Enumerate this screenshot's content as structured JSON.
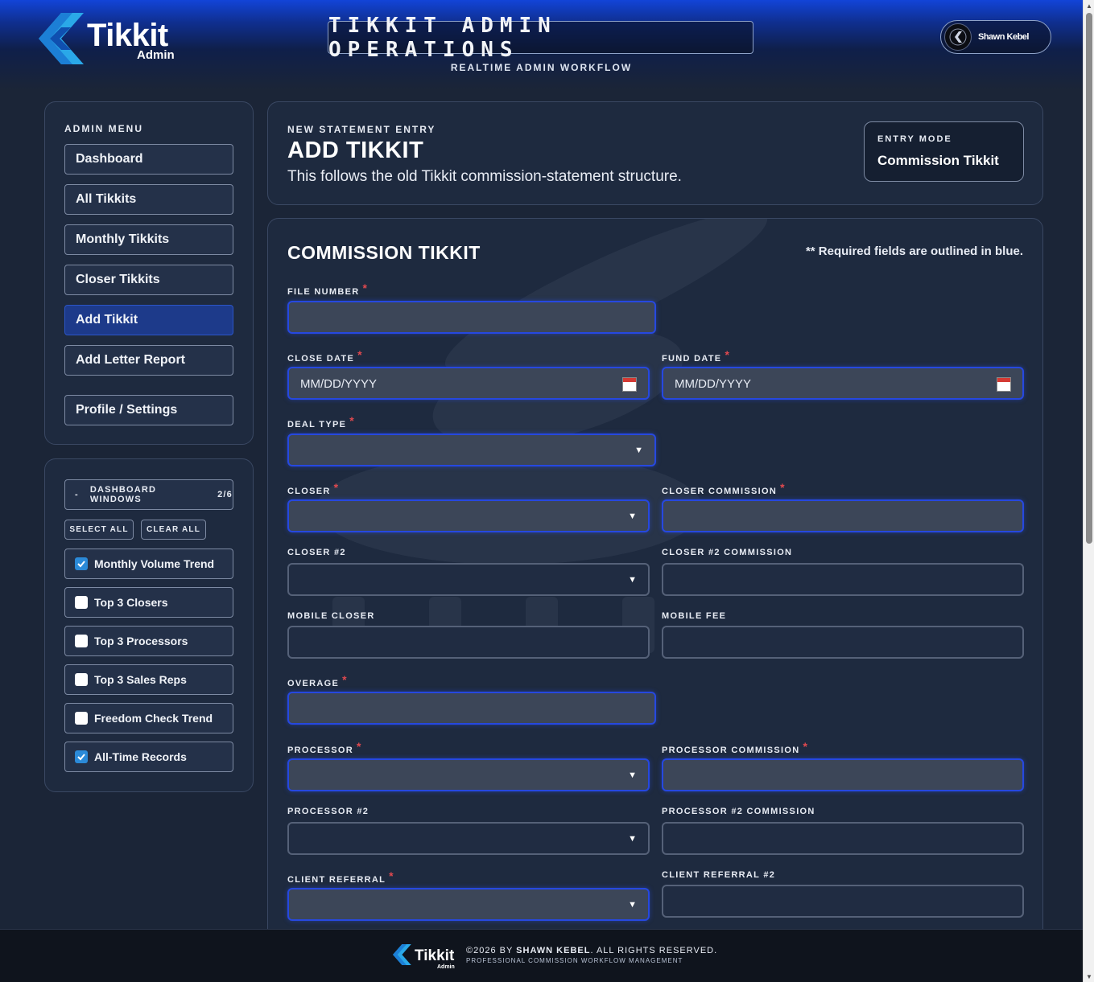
{
  "header": {
    "logo_text": "Tikkit",
    "logo_sub": "Admin",
    "title": "TIKKIT ADMIN OPERATIONS",
    "subtitle": "REALTIME ADMIN WORKFLOW",
    "user_name": "Shawn Kebel"
  },
  "menu": {
    "heading": "ADMIN MENU",
    "items": [
      {
        "label": "Dashboard"
      },
      {
        "label": "All Tikkits"
      },
      {
        "label": "Monthly Tikkits"
      },
      {
        "label": "Closer Tikkits"
      },
      {
        "label": "Add Tikkit",
        "active": true
      },
      {
        "label": "Add Letter Report"
      },
      {
        "label": "Profile / Settings"
      }
    ]
  },
  "windows": {
    "toggle_symbol": "-",
    "label": "DASHBOARD WINDOWS",
    "count": "2/6",
    "select_all": "SELECT ALL",
    "clear_all": "CLEAR ALL",
    "items": [
      {
        "label": "Monthly Volume Trend",
        "checked": true
      },
      {
        "label": "Top 3 Closers",
        "checked": false
      },
      {
        "label": "Top 3 Processors",
        "checked": false
      },
      {
        "label": "Top 3 Sales Reps",
        "checked": false
      },
      {
        "label": "Freedom Check Trend",
        "checked": false
      },
      {
        "label": "All-Time Records",
        "checked": true
      }
    ]
  },
  "entry": {
    "kicker": "NEW STATEMENT ENTRY",
    "title": "ADD TIKKIT",
    "description": "This follows the old Tikkit commission-statement structure.",
    "mode_label": "ENTRY MODE",
    "mode_value": "Commission Tikkit"
  },
  "form": {
    "title": "COMMISSION TIKKIT",
    "note": "** Required fields are outlined in blue.",
    "required_mark": "*",
    "date_placeholder": "MM/DD/YYYY",
    "fields": {
      "file_number": "FILE NUMBER",
      "close_date": "CLOSE DATE",
      "fund_date": "FUND DATE",
      "deal_type": "DEAL TYPE",
      "closer": "CLOSER",
      "closer_commission": "CLOSER COMMISSION",
      "closer2": "CLOSER #2",
      "closer2_commission": "CLOSER #2 COMMISSION",
      "mobile_closer": "MOBILE CLOSER",
      "mobile_fee": "MOBILE FEE",
      "overage": "OVERAGE",
      "processor": "PROCESSOR",
      "processor_commission": "PROCESSOR COMMISSION",
      "processor2": "PROCESSOR #2",
      "processor2_commission": "PROCESSOR #2 COMMISSION",
      "client_referral": "CLIENT REFERRAL",
      "client_referral2": "CLIENT REFERRAL #2"
    }
  },
  "footer": {
    "logo_text": "Tikkit",
    "logo_sub": "Admin",
    "copyright_prefix": "©2026 BY ",
    "copyright_name": "SHAWN KEBEL",
    "copyright_suffix": ". ALL RIGHTS RESERVED.",
    "tagline": "PROFESSIONAL COMMISSION WORKFLOW MANAGEMENT"
  },
  "colors": {
    "accent": "#2648e0",
    "active_menu": "#1d3a8a",
    "required_star": "#e0494f",
    "checkbox_checked": "#2b8ad8"
  }
}
